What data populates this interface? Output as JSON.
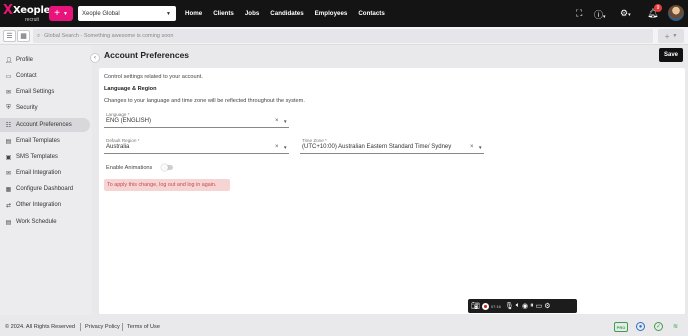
{
  "topbar": {
    "logo_text": "Xeople",
    "logo_sub": "recruit",
    "add_label": "+",
    "org_name": "Xeople Global",
    "nav": [
      "Home",
      "Clients",
      "Jobs",
      "Candidates",
      "Employees",
      "Contacts"
    ],
    "notification_count": "9",
    "icons": [
      "fullscreen-icon",
      "help-icon",
      "settings-icon",
      "bell-icon",
      "avatar"
    ]
  },
  "subbar": {
    "search_placeholder": "Global Search - Something awesome is coming soon",
    "plus_label": "+"
  },
  "sidebar": {
    "items": [
      {
        "label": "Profile",
        "icon": "person-icon"
      },
      {
        "label": "Contact",
        "icon": "contact-card-icon"
      },
      {
        "label": "Email Settings",
        "icon": "email-icon"
      },
      {
        "label": "Security",
        "icon": "shield-icon"
      },
      {
        "label": "Account Preferences",
        "icon": "preferences-icon",
        "active": true
      },
      {
        "label": "Email Templates",
        "icon": "template-icon"
      },
      {
        "label": "SMS Templates",
        "icon": "sms-icon"
      },
      {
        "label": "Email Integration",
        "icon": "integration-icon"
      },
      {
        "label": "Configure Dashboard",
        "icon": "dashboard-icon"
      },
      {
        "label": "Other Integration",
        "icon": "plug-icon"
      },
      {
        "label": "Work Schedule",
        "icon": "calendar-icon"
      }
    ]
  },
  "main": {
    "title": "Account Preferences",
    "save_label": "Save",
    "intro": "Control settings related to your account.",
    "section_title": "Language & Region",
    "section_desc": "Changes to your language and time zone will be reflected throughout the system.",
    "language": {
      "label": "Language *",
      "value": "ENG (ENGLISH)"
    },
    "region": {
      "label": "Default Region *",
      "value": "Australia"
    },
    "timezone": {
      "label": "Time Zone *",
      "value": "(UTC+10:00) Australian Eastern Standard Time/ Sydney"
    },
    "animations_label": "Enable Animations",
    "animations_enabled": false,
    "alert": "To apply this change, log out and log in again."
  },
  "recorder": {
    "time": "07:16"
  },
  "footer": {
    "copyright": "© 2024. All Rights Reserved",
    "privacy": "Privacy Policy",
    "terms": "Terms of Use",
    "pro_badge": "PRO",
    "colors": {
      "pro": "#3aa04a",
      "accent": "#e8147b",
      "alert_bg": "#f7d4d4",
      "alert_text": "#c64a4a"
    }
  }
}
